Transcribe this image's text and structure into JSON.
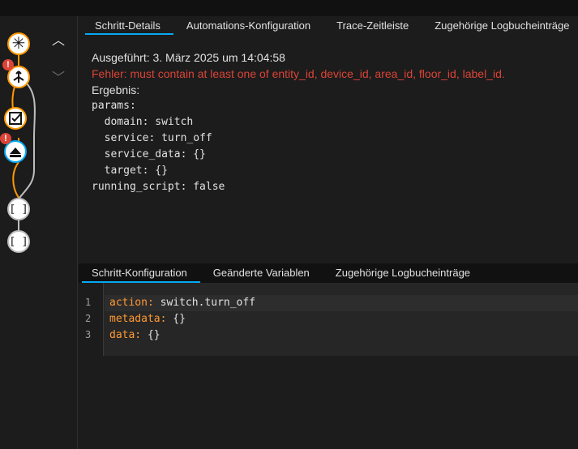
{
  "tabs_top": [
    {
      "label": "Schritt-Details",
      "active": true
    },
    {
      "label": "Automations-Konfiguration",
      "active": false
    },
    {
      "label": "Trace-Zeitleiste",
      "active": false
    },
    {
      "label": "Zugehörige Logbucheinträge",
      "active": false
    }
  ],
  "details": {
    "executed": "Ausgeführt: 3. März 2025 um 14:04:58",
    "error": "Fehler: must contain at least one of entity_id, device_id, area_id, floor_id, label_id.",
    "result_label": "Ergebnis:",
    "result_yaml": "params:\n  domain: switch\n  service: turn_off\n  service_data: {}\n  target: {}\nrunning_script: false"
  },
  "tabs_bottom": [
    {
      "label": "Schritt-Konfiguration",
      "active": true
    },
    {
      "label": "Geänderte Variablen",
      "active": false
    },
    {
      "label": "Zugehörige Logbucheinträge",
      "active": false
    }
  ],
  "code": {
    "lines": [
      {
        "num": "1",
        "key": "action:",
        "value": " switch.turn_off"
      },
      {
        "num": "2",
        "key": "metadata:",
        "value": " {}"
      },
      {
        "num": "3",
        "key": "data:",
        "value": " {}"
      }
    ]
  },
  "graph": {
    "nodes": [
      "trigger-icon",
      "choose-icon",
      "condition-icon",
      "service-icon",
      "sequence-icon",
      "sequence-icon"
    ],
    "badge": "!"
  },
  "colors": {
    "accent": "#03a9f4",
    "orange": "#ff9800",
    "error": "#db4437",
    "key": "#ff9933"
  }
}
